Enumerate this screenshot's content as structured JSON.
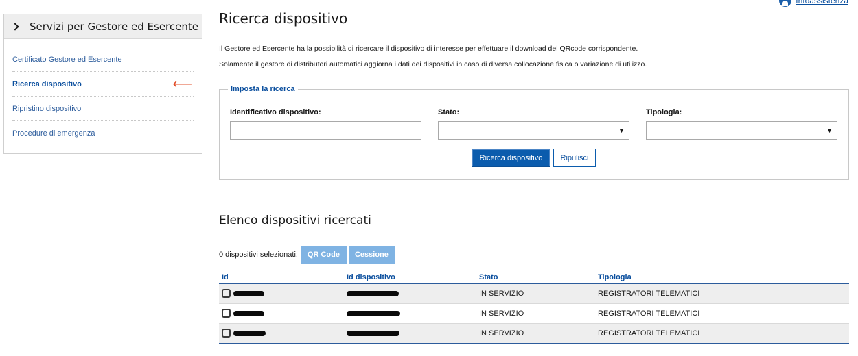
{
  "help": {
    "label": "Infoassistenza"
  },
  "sidebar": {
    "title": "Servizi per Gestore ed Esercente",
    "items": [
      {
        "label": "Certificato Gestore ed Esercente",
        "active": false
      },
      {
        "label": "Ricerca dispositivo",
        "active": true
      },
      {
        "label": "Ripristino dispositivo",
        "active": false
      },
      {
        "label": "Procedure di emergenza",
        "active": false
      }
    ]
  },
  "main": {
    "title": "Ricerca dispositivo",
    "description": [
      "Il Gestore ed Esercente ha la possibilità di ricercare il dispositivo di interesse per effettuare il download del QRcode corrispondente.",
      "Solamente il gestore di distributori automatici aggiorna i dati dei dispositivi in caso di diversa collocazione fisica o variazione di utilizzo."
    ],
    "search": {
      "legend": "Imposta la ricerca",
      "fields": {
        "id": {
          "label": "Identificativo dispositivo:",
          "value": ""
        },
        "stato": {
          "label": "Stato:",
          "value": ""
        },
        "tipologia": {
          "label": "Tipologia:",
          "value": ""
        }
      },
      "search_button": "Ricerca dispositivo",
      "clear_button": "Ripulisci"
    },
    "results": {
      "title": "Elenco dispositivi ricercati",
      "selected_label": "0 dispositivi selezionati:",
      "qr_button": "QR Code",
      "cession_button": "Cessione",
      "columns": [
        "Id",
        "Id dispositivo",
        "Stato",
        "Tipologia"
      ],
      "rows": [
        {
          "stato": "IN SERVIZIO",
          "tipologia": "REGISTRATORI TELEMATICI"
        },
        {
          "stato": "IN SERVIZIO",
          "tipologia": "REGISTRATORI TELEMATICI"
        },
        {
          "stato": "IN SERVIZIO",
          "tipologia": "REGISTRATORI TELEMATICI"
        }
      ]
    }
  },
  "colors": {
    "primary": "#0b5cad",
    "link": "#0b4f9e",
    "disabled_button": "#7fb3e3",
    "active_arrow": "#e2502c"
  }
}
